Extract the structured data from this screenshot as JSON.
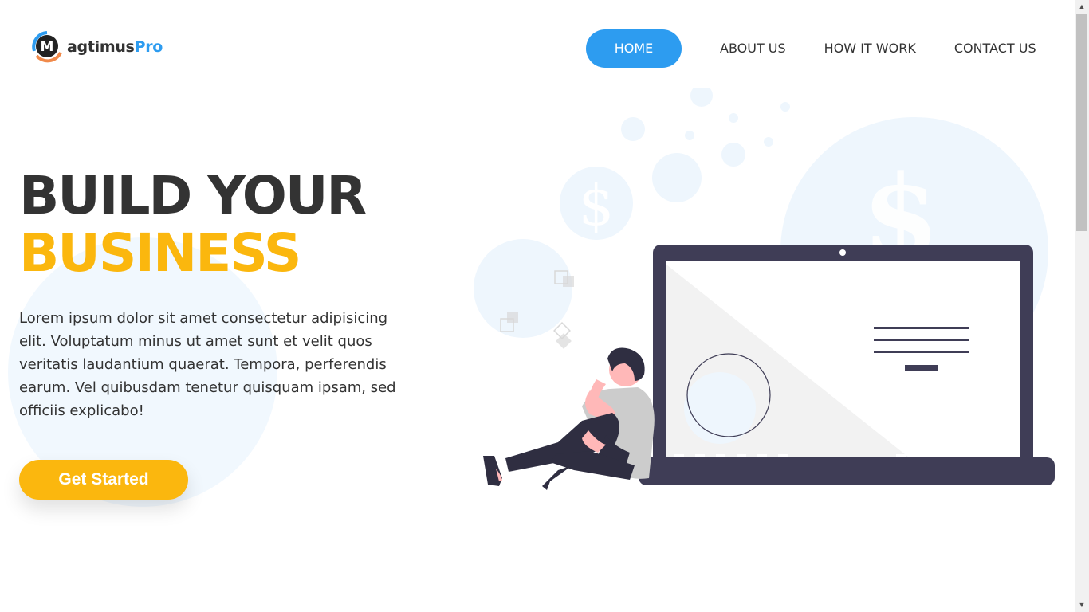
{
  "brand": {
    "name_main": "agtimus",
    "name_accent": "Pro",
    "logo_letter": "M"
  },
  "nav": {
    "items": [
      {
        "label": "HOME",
        "active": true
      },
      {
        "label": "ABOUT US",
        "active": false
      },
      {
        "label": "HOW IT WORK",
        "active": false
      },
      {
        "label": "CONTACT US",
        "active": false
      }
    ]
  },
  "hero": {
    "title_line1": "BUILD YOUR",
    "title_line2": "BUSINESS",
    "description": "Lorem ipsum dolor sit amet consectetur adipisicing elit. Voluptatum minus ut amet sunt et velit quos veritatis laudantium quaerat. Tempora, perferendis earum. Vel quibusdam tenetur quisquam ipsam, sed officiis explicabo!",
    "cta_label": "Get Started"
  },
  "colors": {
    "accent_blue": "#2d9cf0",
    "accent_yellow": "#fbb70e",
    "text_dark": "#333333",
    "laptop": "#3f3d56",
    "bubble": "#eef6fd"
  },
  "illustration": {
    "symbol": "$"
  }
}
